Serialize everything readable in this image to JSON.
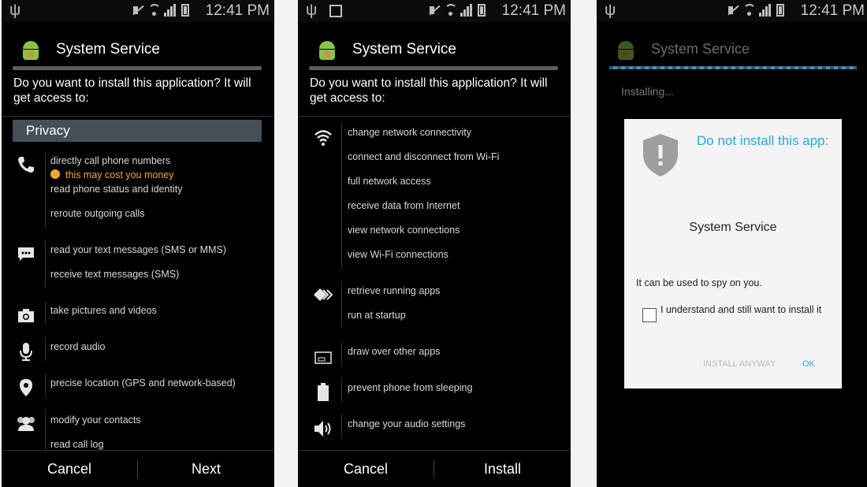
{
  "status_bar": {
    "time": "12:41 PM"
  },
  "screen1": {
    "app_title": "System Service",
    "question": "Do you want to install this application? It will get access to:",
    "section_header": "Privacy",
    "groups": [
      {
        "icon": "phone-icon",
        "items": [
          "directly call phone numbers",
          "this may cost you money",
          "read phone status and identity",
          "reroute outgoing calls"
        ]
      },
      {
        "icon": "message-icon",
        "items": [
          "read your text messages (SMS or MMS)",
          "receive text messages (SMS)"
        ]
      },
      {
        "icon": "camera-icon",
        "items": [
          "take pictures and videos"
        ]
      },
      {
        "icon": "microphone-icon",
        "items": [
          "record audio"
        ]
      },
      {
        "icon": "location-pin-icon",
        "items": [
          "precise location (GPS and network-based)"
        ]
      },
      {
        "icon": "contacts-icon",
        "items": [
          "modify your contacts",
          "read call log"
        ]
      }
    ],
    "buttons": {
      "cancel": "Cancel",
      "next": "Next"
    }
  },
  "screen2": {
    "app_title": "System Service",
    "question": "Do you want to install this application? It will get access to:",
    "groups": [
      {
        "icon": "wifi-icon",
        "items": [
          "change network connectivity",
          "connect and disconnect from Wi-Fi",
          "full network access",
          "receive data from Internet",
          "view network connections",
          "view Wi-Fi connections"
        ]
      },
      {
        "icon": "running-apps-icon",
        "items": [
          "retrieve running apps",
          "run at startup"
        ]
      },
      {
        "icon": "overlay-icon",
        "items": [
          "draw over other apps"
        ]
      },
      {
        "icon": "battery-icon",
        "items": [
          "prevent phone from sleeping"
        ]
      },
      {
        "icon": "speaker-icon",
        "items": [
          "change your audio settings"
        ]
      }
    ],
    "buttons": {
      "cancel": "Cancel",
      "install": "Install"
    }
  },
  "screen3": {
    "app_title": "System Service",
    "installing_text": "Installing...",
    "dialog": {
      "title": "Do not install this app:",
      "app_name": "System Service",
      "warning": "It can be used to spy on you.",
      "checkbox_label": "I understand and still want to install it",
      "checkbox_checked": false,
      "install_anyway": "INSTALL ANYWAY",
      "ok": "OK"
    }
  },
  "colors": {
    "accent": "#2da6d8",
    "warning": "#f3a733",
    "section_header_bg": "#454f57",
    "dialog_bg": "#f4f4f4"
  }
}
